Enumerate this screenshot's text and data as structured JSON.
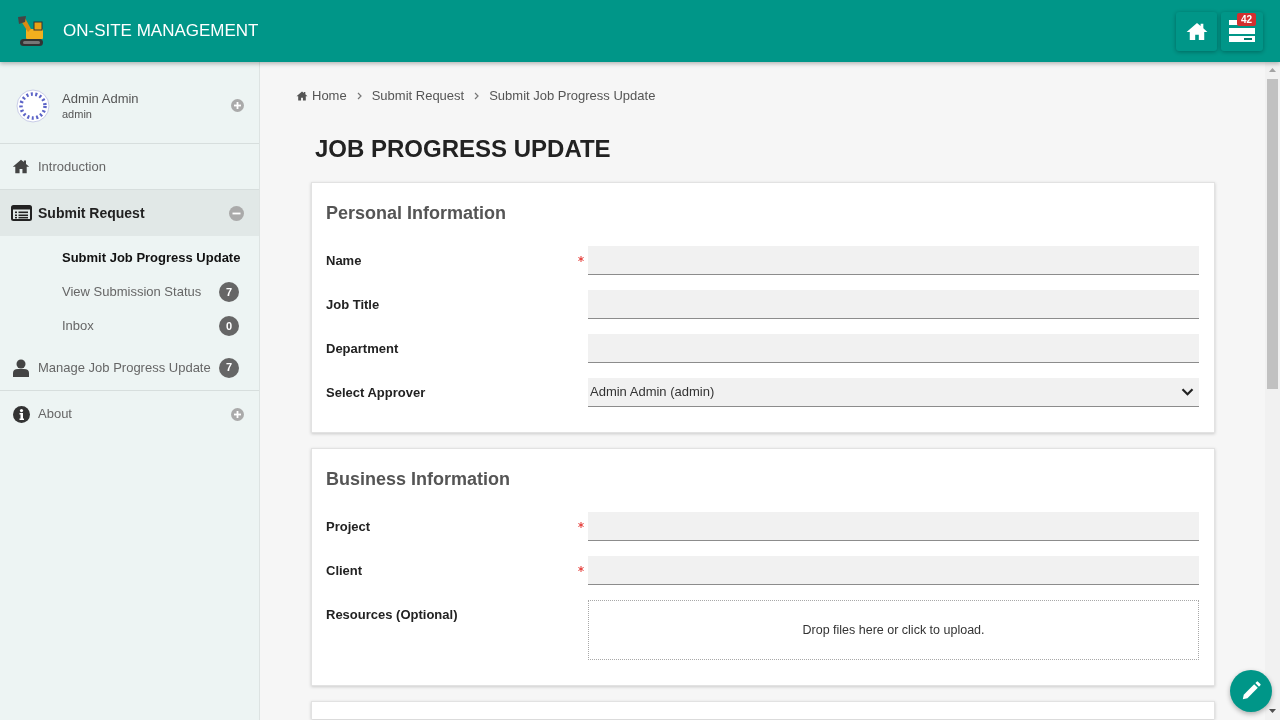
{
  "header": {
    "title": "ON-SITE MANAGEMENT",
    "notification_count": "42"
  },
  "sidebar": {
    "user": {
      "name": "Admin Admin",
      "username": "admin",
      "expanded": false
    },
    "items": [
      {
        "kind": "link",
        "label": "Introduction",
        "selected": false
      },
      {
        "kind": "group",
        "label": "Submit Request",
        "selected": true,
        "expanded": true,
        "children": [
          {
            "label": "Submit Job Progress Update",
            "selected": true
          },
          {
            "label": "View Submission Status",
            "selected": false,
            "badge": "7"
          },
          {
            "label": "Inbox",
            "selected": false,
            "badge": "0"
          }
        ]
      },
      {
        "kind": "link",
        "label": "Manage Job Progress Update",
        "selected": false,
        "badge": "7"
      },
      {
        "kind": "group",
        "label": "About",
        "selected": false,
        "expanded": false
      }
    ]
  },
  "breadcrumb": [
    "Home",
    "Submit Request",
    "Submit Job Progress Update"
  ],
  "page_title": "JOB PROGRESS UPDATE",
  "sections": [
    {
      "title": "Personal Information",
      "fields": [
        {
          "label": "Name",
          "kind": "text",
          "required": true
        },
        {
          "label": "Job Title",
          "kind": "text",
          "required": false
        },
        {
          "label": "Department",
          "kind": "text",
          "required": false
        },
        {
          "label": "Select Approver",
          "kind": "select",
          "required": false,
          "value": "Admin Admin (admin)"
        }
      ]
    },
    {
      "title": "Business Information",
      "fields": [
        {
          "label": "Project",
          "kind": "text",
          "required": true
        },
        {
          "label": "Client",
          "kind": "text",
          "required": true
        },
        {
          "label": "Resources (Optional)",
          "kind": "dropzone",
          "required": false,
          "prompt": "Drop files here or click to upload."
        }
      ]
    }
  ]
}
